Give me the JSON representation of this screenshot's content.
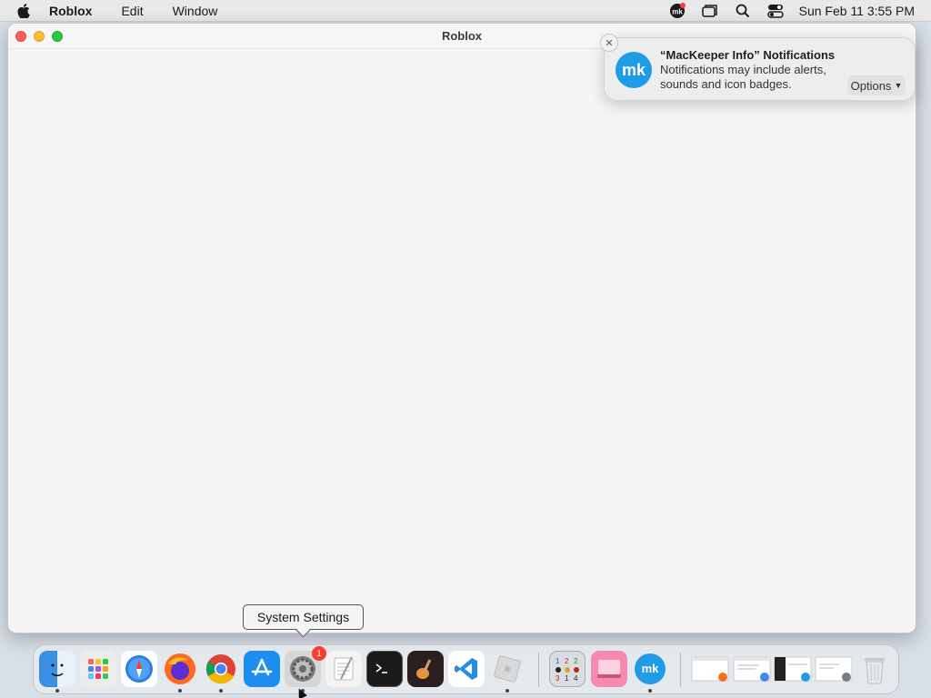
{
  "menubar": {
    "app_name": "Roblox",
    "menus": [
      "Edit",
      "Window"
    ],
    "clock": "Sun Feb 11  3:55 PM",
    "status_icons": [
      "mackeeper-icon",
      "window-icon",
      "search-icon",
      "control-center-icon"
    ]
  },
  "window": {
    "title": "Roblox"
  },
  "notification": {
    "title": "“MacKeeper Info” Notifications",
    "body": "Notifications may include alerts, sounds and icon badges.",
    "options_label": "Options",
    "icon_text": "mk"
  },
  "tooltip": {
    "label": "System Settings"
  },
  "dock": {
    "badge_count": "1",
    "items": [
      {
        "name": "finder",
        "color": "#3a8ee6"
      },
      {
        "name": "launchpad",
        "color": "#e9e9e9"
      },
      {
        "name": "safari",
        "color": "#2d7fe0"
      },
      {
        "name": "firefox",
        "color": "#ff6a1f"
      },
      {
        "name": "chrome",
        "color": "#e9e9e9"
      },
      {
        "name": "app-store",
        "color": "#1d8df0"
      },
      {
        "name": "system-settings",
        "color": "#8a8a8a"
      },
      {
        "name": "textedit",
        "color": "#f2f2f2"
      },
      {
        "name": "terminal",
        "color": "#1a1a1a"
      },
      {
        "name": "garageband",
        "color": "#3a2a2a"
      },
      {
        "name": "vscode",
        "color": "#2a8ce0"
      },
      {
        "name": "roblox",
        "color": "#d8d8d8"
      },
      {
        "name": "sudoku",
        "color": "#d9dde0"
      },
      {
        "name": "cleanmymac",
        "color": "#f48ab0"
      },
      {
        "name": "mackeeper",
        "color": "#1f9be8"
      },
      {
        "name": "recent-window-1",
        "color": "#f4f4f4"
      },
      {
        "name": "recent-window-2",
        "color": "#f4f4f4"
      },
      {
        "name": "recent-window-3",
        "color": "#f4f4f4"
      },
      {
        "name": "recent-window-4",
        "color": "#f4f4f4"
      },
      {
        "name": "trash",
        "color": "#e6e9ec"
      }
    ]
  }
}
